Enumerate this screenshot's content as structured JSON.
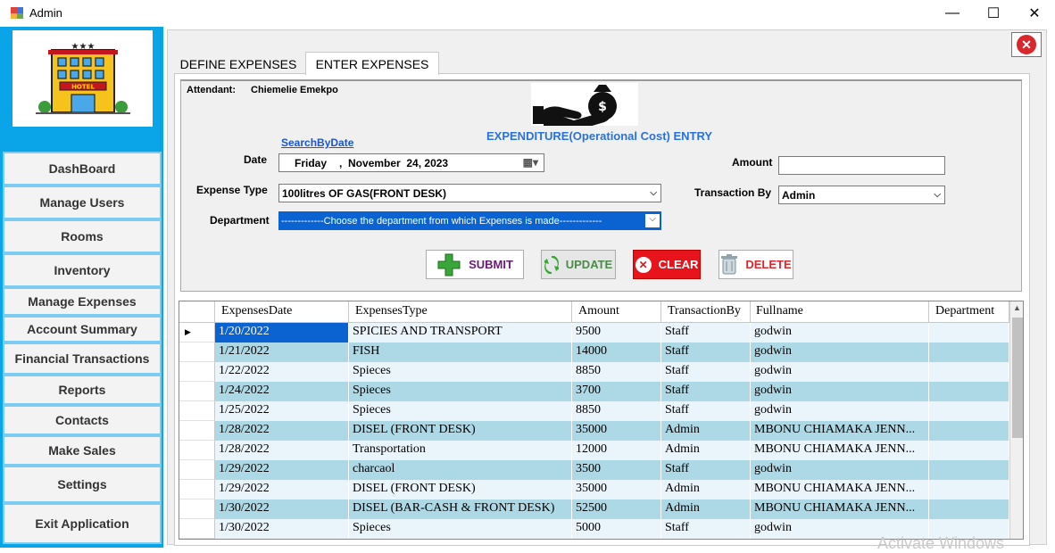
{
  "window": {
    "title": "Admin",
    "minimize": "—",
    "maximize": "☐",
    "close": "✕"
  },
  "logo": {
    "hotel_sign": "HOTEL",
    "stars": "★★★"
  },
  "sidebar": {
    "items": [
      {
        "label": "DashBoard"
      },
      {
        "label": "Manage Users"
      },
      {
        "label": "Rooms"
      },
      {
        "label": "Inventory"
      },
      {
        "label": "Manage Expenses"
      },
      {
        "label": "Account Summary"
      },
      {
        "label": "Financial Transactions"
      },
      {
        "label": "Reports"
      },
      {
        "label": "Contacts"
      },
      {
        "label": "Make Sales"
      },
      {
        "label": "Settings"
      },
      {
        "label": "Exit Application"
      }
    ]
  },
  "tabs": [
    {
      "label": "DEFINE EXPENSES"
    },
    {
      "label": "ENTER EXPENSES"
    }
  ],
  "form": {
    "attendant_label": "Attendant:",
    "attendant_name": "Chiemelie Emekpo",
    "title": "EXPENDITURE(Operational Cost) ENTRY",
    "search_by_date": "SearchByDate",
    "date_label": "Date",
    "date_day": "Friday",
    "date_value": ",  November  24, 2023",
    "amount_label": "Amount",
    "amount_value": "",
    "expense_type_label": "Expense Type",
    "expense_type_value": "100litres OF GAS(FRONT DESK)",
    "transaction_by_label": "Transaction By",
    "transaction_by_value": "Admin",
    "department_label": "Department",
    "department_value": "-------------Choose the department from which Expenses is made-------------"
  },
  "buttons": {
    "submit": "SUBMIT",
    "update": "UPDATE",
    "clear": "CLEAR",
    "delete": "DELETE"
  },
  "colors": {
    "sidebar_bg": "#0aa5e8",
    "title_blue": "#2a72d8",
    "row_alt": "#add8e6",
    "row_base": "#eaf5fb",
    "selected": "#0a63d1"
  },
  "grid": {
    "columns": [
      "ExpensesDate",
      "ExpensesType",
      "Amount",
      "TransactionBy",
      "Fullname",
      "Department"
    ],
    "rows": [
      [
        "1/20/2022",
        "SPICIES AND TRANSPORT",
        "9500",
        "Staff",
        "godwin",
        ""
      ],
      [
        "1/21/2022",
        "FISH",
        "14000",
        "Staff",
        "godwin",
        ""
      ],
      [
        "1/22/2022",
        "Spieces",
        "8850",
        "Staff",
        "godwin",
        ""
      ],
      [
        "1/24/2022",
        "Spieces",
        "3700",
        "Staff",
        "godwin",
        ""
      ],
      [
        "1/25/2022",
        "Spieces",
        "8850",
        "Staff",
        "godwin",
        ""
      ],
      [
        "1/28/2022",
        "DISEL (FRONT DESK)",
        "35000",
        "Admin",
        "MBONU CHIAMAKA JENN...",
        ""
      ],
      [
        "1/28/2022",
        "Transportation",
        "12000",
        "Admin",
        "MBONU CHIAMAKA JENN...",
        ""
      ],
      [
        "1/29/2022",
        "charcaol",
        "3500",
        "Staff",
        "godwin",
        ""
      ],
      [
        "1/29/2022",
        "DISEL (FRONT DESK)",
        "35000",
        "Admin",
        "MBONU CHIAMAKA JENN...",
        ""
      ],
      [
        "1/30/2022",
        "DISEL (BAR-CASH & FRONT DESK)",
        "52500",
        "Admin",
        "MBONU CHIAMAKA JENN...",
        ""
      ],
      [
        "1/30/2022",
        "Spieces",
        "5000",
        "Staff",
        "godwin",
        ""
      ]
    ]
  },
  "watermark": "Activate Windows"
}
